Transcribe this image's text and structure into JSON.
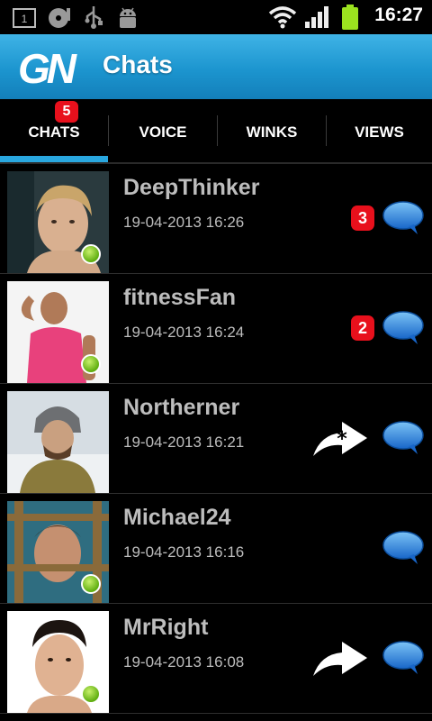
{
  "status_bar": {
    "time": "16:27",
    "icons": [
      "notification-1-icon",
      "media-icon",
      "usb-icon",
      "android-debug-icon",
      "wifi-icon",
      "signal-icon",
      "battery-icon"
    ],
    "notification_count": "1"
  },
  "header": {
    "logo_text": "GN",
    "title": "Chats"
  },
  "tabs": [
    {
      "label": "CHATS",
      "badge": "5",
      "selected": true
    },
    {
      "label": "VOICE"
    },
    {
      "label": "WINKS"
    },
    {
      "label": "VIEWS"
    }
  ],
  "colors": {
    "accent": "#29a7df",
    "badge": "#e8101c",
    "online": "#6cbd1a",
    "chat_bubble": "#1e7fd6"
  },
  "chats": [
    {
      "name": "DeepThinker",
      "time": "19-04-2013 16:26",
      "unread": "3",
      "online": true,
      "action_icon": null
    },
    {
      "name": "fitnessFan",
      "time": "19-04-2013 16:24",
      "unread": "2",
      "online": true,
      "action_icon": null
    },
    {
      "name": "Northerner",
      "time": "19-04-2013 16:21",
      "unread": null,
      "online": false,
      "action_icon": "wink-reply-icon"
    },
    {
      "name": "Michael24",
      "time": "19-04-2013 16:16",
      "unread": null,
      "online": true,
      "action_icon": null
    },
    {
      "name": "MrRight",
      "time": "19-04-2013 16:08",
      "unread": null,
      "online": true,
      "action_icon": "reply-arrow-icon"
    }
  ]
}
